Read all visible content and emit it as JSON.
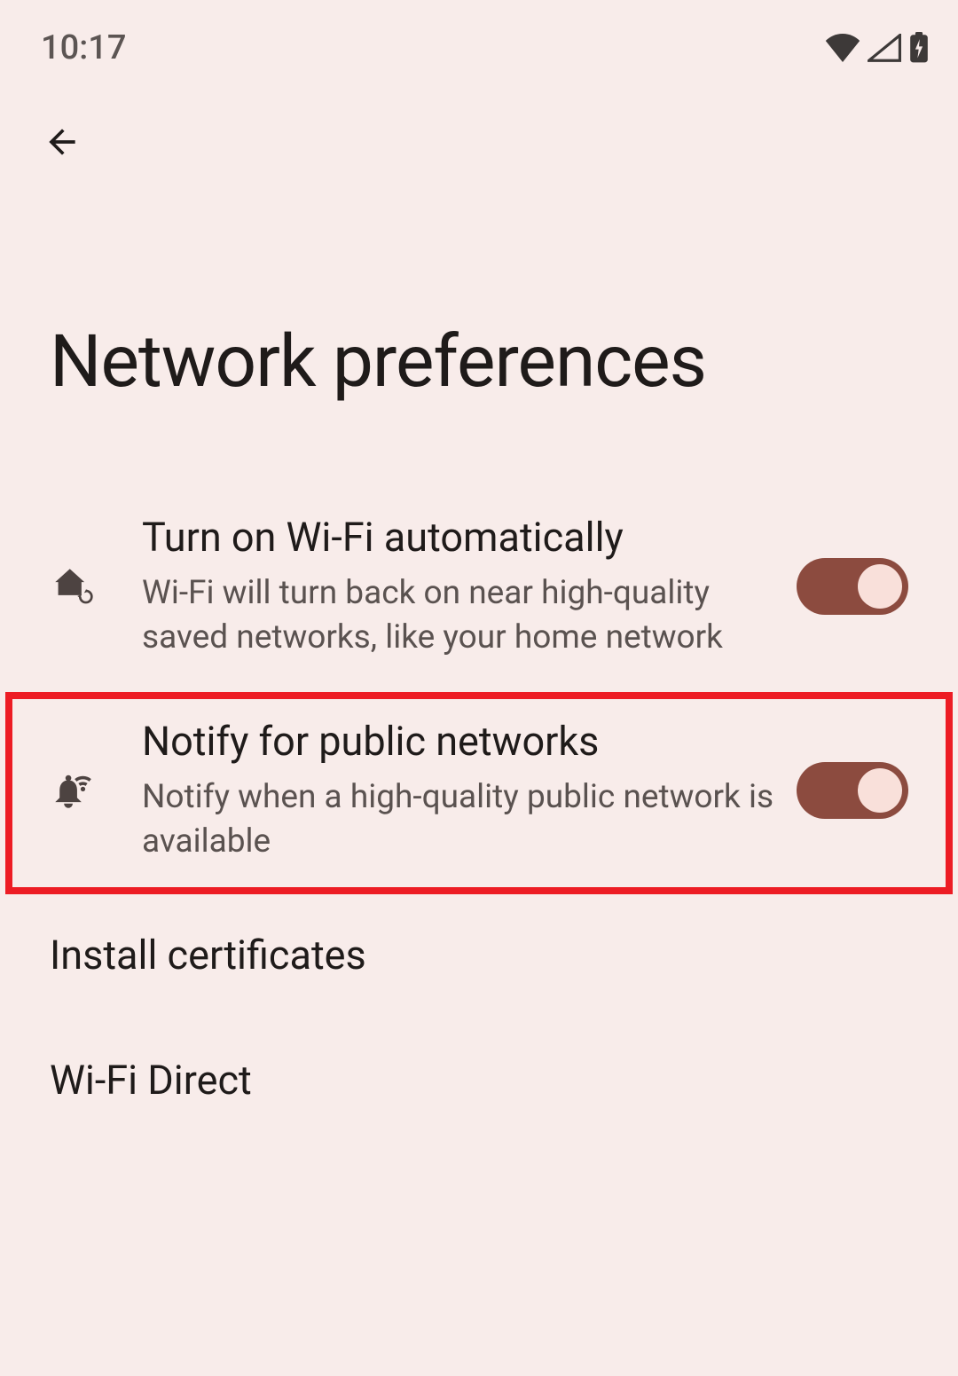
{
  "status": {
    "time": "10:17"
  },
  "page": {
    "title": "Network preferences"
  },
  "settings": {
    "auto_wifi": {
      "title": "Turn on Wi-Fi automatically",
      "subtitle": "Wi-Fi will turn back on near high-quality saved networks, like your home network",
      "enabled": true
    },
    "notify_public": {
      "title": "Notify for public networks",
      "subtitle": "Notify when a high-quality public network is available",
      "enabled": true
    },
    "install_certs": {
      "title": "Install certificates"
    },
    "wifi_direct": {
      "title": "Wi-Fi Direct"
    }
  }
}
